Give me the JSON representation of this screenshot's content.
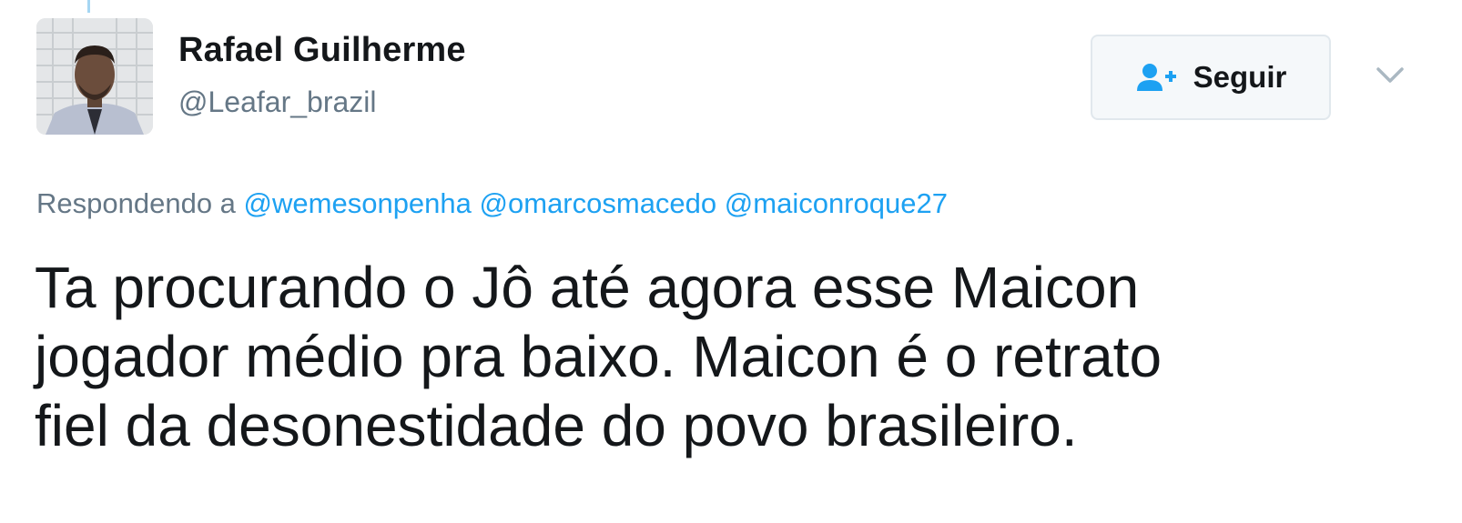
{
  "user": {
    "name": "Rafael Guilherme",
    "handle": "@Leafar_brazil"
  },
  "follow_button": {
    "label": "Seguir",
    "icon": "add-user-icon"
  },
  "menu": {
    "icon": "chevron-down-icon"
  },
  "reply": {
    "prefix": "Respondendo a",
    "mentions": [
      "@wemesonpenha",
      "@omarcosmacedo",
      "@maiconroque27"
    ]
  },
  "tweet": {
    "lines": [
      "Ta procurando o Jô até agora esse Maicon",
      "jogador médio pra baixo. Maicon é o retrato",
      "fiel da desonestidade do povo brasileiro."
    ]
  },
  "colors": {
    "accent": "#1da1f2",
    "text": "#14171a",
    "secondary": "#657786",
    "button_bg": "#f5f8fa",
    "button_border": "#e1e8ed"
  }
}
